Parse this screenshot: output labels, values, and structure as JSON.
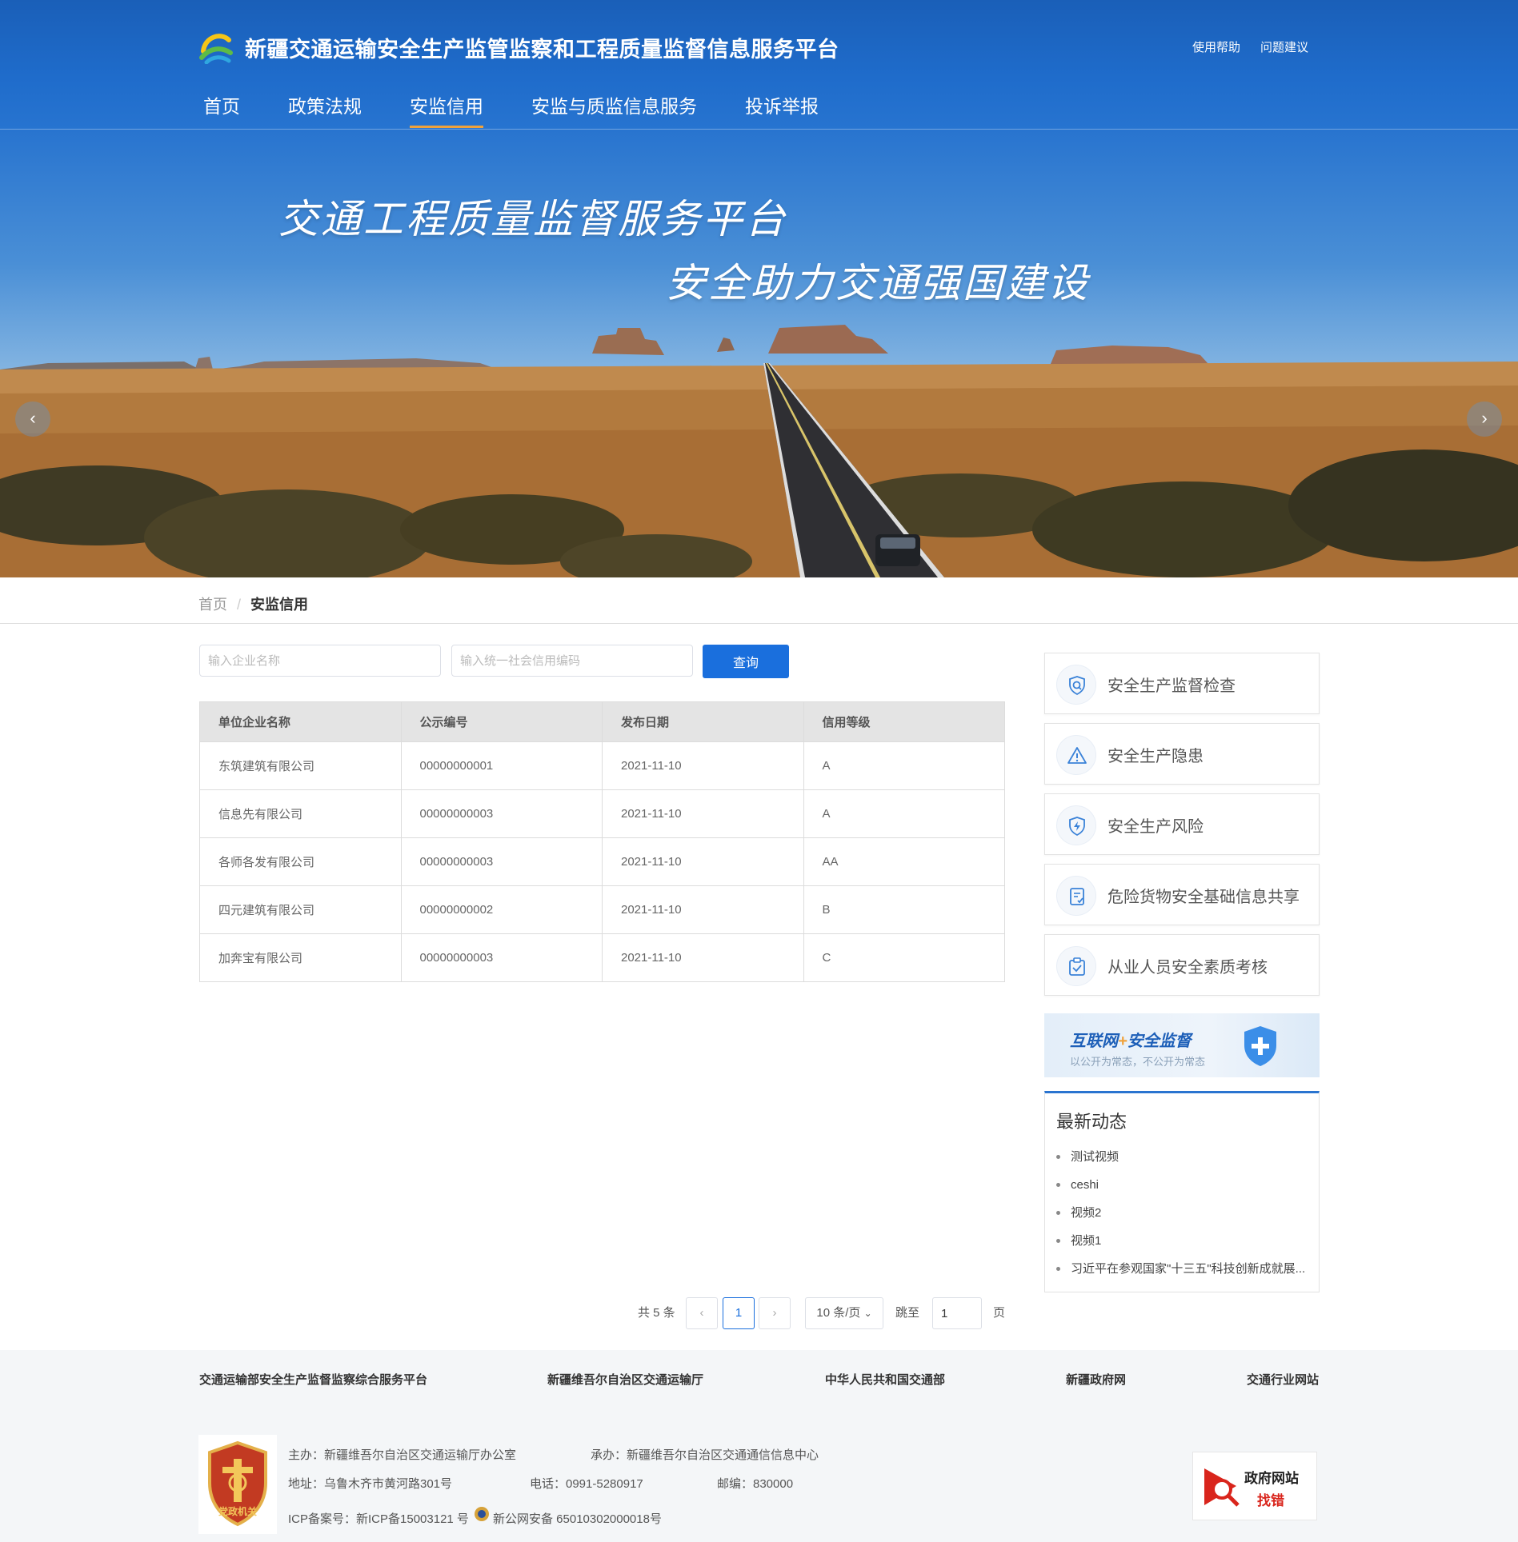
{
  "header": {
    "site_title": "新疆交通运输安全生产监管监察和工程质量监督信息服务平台",
    "links": {
      "help": "使用帮助",
      "feedback": "问题建议"
    },
    "nav": [
      {
        "label": "首页"
      },
      {
        "label": "政策法规"
      },
      {
        "label": "安监信用",
        "active": true
      },
      {
        "label": "安监与质监信息服务"
      },
      {
        "label": "投诉举报"
      }
    ],
    "accent_color": "#f0a23c",
    "brand_color": "#1f6ccb"
  },
  "banner": {
    "slogan_main": "交通工程质量监督服务平台",
    "slogan_sub": "安全助力交通强国建设",
    "prev_icon": "chevron-left-icon",
    "next_icon": "chevron-right-icon"
  },
  "breadcrumb": {
    "home": "首页",
    "separator": "/",
    "current": "安监信用"
  },
  "search": {
    "company_placeholder": "输入企业名称",
    "credit_code_placeholder": "输入统一社会信用编码",
    "query_label": "查询"
  },
  "table": {
    "headers": [
      "单位企业名称",
      "公示编号",
      "发布日期",
      "信用等级"
    ],
    "rows": [
      [
        "东筑建筑有限公司",
        "00000000001",
        "2021-11-10",
        "A"
      ],
      [
        "信息先有限公司",
        "00000000003",
        "2021-11-10",
        "A"
      ],
      [
        "各师各发有限公司",
        "00000000003",
        "2021-11-10",
        "AA"
      ],
      [
        "四元建筑有限公司",
        "00000000002",
        "2021-11-10",
        "B"
      ],
      [
        "加奔宝有限公司",
        "00000000003",
        "2021-11-10",
        "C"
      ]
    ]
  },
  "pagination": {
    "total": "共 5 条",
    "prev": "‹",
    "current_page": "1",
    "next": "›",
    "page_size": "10 条/页",
    "jump_label": "跳至",
    "jump_value": "1",
    "page_unit": "页"
  },
  "sidebar": {
    "cards": [
      {
        "label": "安全生产监督检查",
        "icon": "search-shield-icon"
      },
      {
        "label": "安全生产隐患",
        "icon": "warning-icon"
      },
      {
        "label": "安全生产风险",
        "icon": "lightning-shield-icon"
      },
      {
        "label": "危险货物安全基础信息共享",
        "icon": "document-check-icon"
      },
      {
        "label": "从业人员安全素质考核",
        "icon": "clipboard-check-icon"
      }
    ],
    "promo": {
      "title_a": "互联网",
      "title_plus": "+",
      "title_b": "安全监督",
      "subtitle": "以公开为常态，不公开为常态"
    },
    "news": {
      "title": "最新动态",
      "items": [
        "测试视频",
        "ceshi",
        "视频2",
        "视频1",
        "习近平在参观国家\"十三五\"科技创新成就展..."
      ]
    }
  },
  "footer": {
    "links": [
      "交通运输部安全生产监督监察综合服务平台",
      "新疆维吾尔自治区交通运输厅",
      "中华人民共和国交通部",
      "新疆政府网",
      "交通行业网站"
    ],
    "sponsor": "主办：新疆维吾尔自治区交通运输厅办公室",
    "organizer": "承办：新疆维吾尔自治区交通通信信息中心",
    "address": "地址：乌鲁木齐市黄河路301号",
    "phone": "电话：0991-5280917",
    "postcode": "邮编：830000",
    "icp": "ICP备案号：新ICP备15003121 号",
    "police": "新公网安备 65010302000018号",
    "emblem_text": "党政机关",
    "badge_line1": "政府网站",
    "badge_line2": "找错"
  }
}
